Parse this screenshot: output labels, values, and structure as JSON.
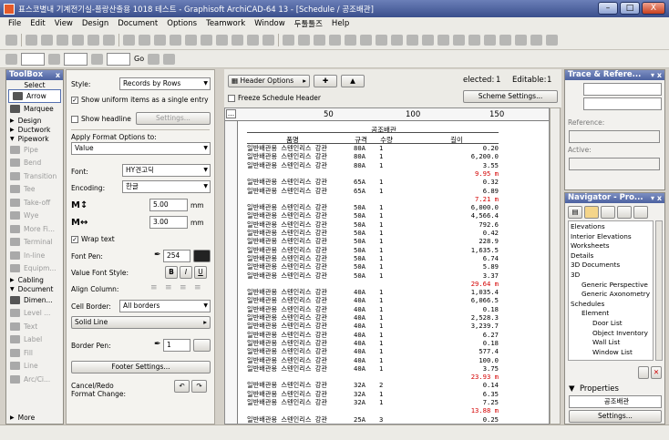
{
  "window": {
    "title": "표스코별내 기계전기실-플랑산출용 1018 테스트 - Graphisoft ArchiCAD-64 13 - [Schedule / 공조배관]",
    "min": "–",
    "max": "□",
    "close": "X"
  },
  "menu": [
    "File",
    "Edit",
    "View",
    "Design",
    "Document",
    "Options",
    "Teamwork",
    "Window",
    "두툴툴즈",
    "Help"
  ],
  "toolbar2": {
    "go_label": "Go"
  },
  "toolbox": {
    "title": "ToolBox",
    "close": "x",
    "select_label": "Select",
    "items_top": [
      {
        "label": "Arrow",
        "icon": "arrow-icon"
      },
      {
        "label": "Marquee",
        "icon": "marquee-icon"
      }
    ],
    "categories": [
      "Design",
      "Ductwork",
      "Pipework"
    ],
    "items_pipe": [
      "Pipe",
      "Bend",
      "Transition",
      "Tee",
      "Take-off",
      "Wye",
      "More Fi...",
      "Terminal",
      "In-line",
      "Equipm..."
    ],
    "cat_cabling": "Cabling",
    "cat_document": "Document",
    "items_doc": [
      "Dimen...",
      "Level ...",
      "Text",
      "Label",
      "Fill",
      "Line",
      "Arc/Ci..."
    ],
    "more": "More"
  },
  "infobox": {
    "style_label": "Style:",
    "style_value": "Records by Rows",
    "uniform_label": "Show uniform items as a single entry",
    "uniform_checked": true,
    "headline_label": "Show headline",
    "headline_checked": false,
    "settings_label": "Settings...",
    "apply_label": "Apply Format Options to:",
    "apply_value": "Value",
    "font_label": "Font:",
    "font_value": "HY견고딕",
    "encoding_label": "Encoding:",
    "encoding_value": "한글",
    "size1_value": "5.00",
    "size1_unit": "mm",
    "size2_value": "3.00",
    "size2_unit": "mm",
    "wrap_label": "Wrap text",
    "wrap_checked": true,
    "fontpen_label": "Font Pen:",
    "fontpen_value": "254",
    "valuefont_label": "Value Font Style:",
    "bold": "B",
    "italic": "I",
    "underline": "U",
    "align_label": "Align Column:",
    "cellborder_label": "Cell Border:",
    "cellborder_value": "All borders",
    "line_value": "Solid Line",
    "borderpen_label": "Border Pen:",
    "borderpen_value": "1",
    "footer_btn": "Footer Settings...",
    "cancel_label": "Cancel/Redo",
    "format_label": "Format Change:"
  },
  "schedule_toolbar": {
    "header_options": "Header Options",
    "elected_label": "elected:",
    "elected_value": "1",
    "editable_label": "Editable:",
    "editable_value": "1",
    "freeze_label": "Freeze Schedule Header",
    "scheme_btn": "Scheme Settings...",
    "ellipsis": "..."
  },
  "ruler": {
    "ticks": [
      "50",
      "100",
      "150"
    ]
  },
  "schedule": {
    "title": "공조배관",
    "headers": [
      "품명",
      "규격",
      "수량",
      "길이"
    ],
    "rows": [
      [
        "일반배관용 스텐인리스 강관",
        "80A",
        "1",
        "0.20",
        false
      ],
      [
        "일반배관용 스텐인리스 강관",
        "80A",
        "1",
        "6,200.0",
        false
      ],
      [
        "일반배관용 스텐인리스 강관",
        "80A",
        "1",
        "3.55",
        false
      ],
      [
        "",
        "",
        "",
        "9.95 m",
        true
      ],
      [
        "일반배관용 스텐인리스 강관",
        "65A",
        "1",
        "0.32",
        false
      ],
      [
        "일반배관용 스텐인리스 강관",
        "65A",
        "1",
        "6.89",
        false
      ],
      [
        "",
        "",
        "",
        "7.21 m",
        true
      ],
      [
        "일반배관용 스텐인리스 강관",
        "50A",
        "1",
        "6,000.0",
        false
      ],
      [
        "일반배관용 스텐인리스 강관",
        "50A",
        "1",
        "4,566.4",
        false
      ],
      [
        "일반배관용 스텐인리스 강관",
        "50A",
        "1",
        "792.6",
        false
      ],
      [
        "일반배관용 스텐인리스 강관",
        "50A",
        "1",
        "0.42",
        false
      ],
      [
        "일반배관용 스텐인리스 강관",
        "50A",
        "1",
        "228.9",
        false
      ],
      [
        "일반배관용 스텐인리스 강관",
        "50A",
        "1",
        "1,635.5",
        false
      ],
      [
        "일반배관용 스텐인리스 강관",
        "50A",
        "1",
        "6.74",
        false
      ],
      [
        "일반배관용 스텐인리스 강관",
        "50A",
        "1",
        "5.89",
        false
      ],
      [
        "일반배관용 스텐인리스 강관",
        "50A",
        "1",
        "3.37",
        false
      ],
      [
        "",
        "",
        "",
        "29.64 m",
        true
      ],
      [
        "일반배관용 스텐인리스 강관",
        "40A",
        "1",
        "1,035.4",
        false
      ],
      [
        "일반배관용 스텐인리스 강관",
        "40A",
        "1",
        "6,066.5",
        false
      ],
      [
        "일반배관용 스텐인리스 강관",
        "40A",
        "1",
        "0.18",
        false
      ],
      [
        "일반배관용 스텐인리스 강관",
        "40A",
        "1",
        "2,528.3",
        false
      ],
      [
        "일반배관용 스텐인리스 강관",
        "40A",
        "1",
        "3,239.7",
        false
      ],
      [
        "일반배관용 스텐인리스 강관",
        "40A",
        "1",
        "6.27",
        false
      ],
      [
        "일반배관용 스텐인리스 강관",
        "40A",
        "1",
        "0.18",
        false
      ],
      [
        "일반배관용 스텐인리스 강관",
        "40A",
        "1",
        "577.4",
        false
      ],
      [
        "일반배관용 스텐인리스 강관",
        "40A",
        "1",
        "100.0",
        false
      ],
      [
        "일반배관용 스텐인리스 강관",
        "40A",
        "1",
        "3.75",
        false
      ],
      [
        "",
        "",
        "",
        "23.93 m",
        true
      ],
      [
        "일반배관용 스텐인리스 강관",
        "32A",
        "2",
        "0.14",
        false
      ],
      [
        "일반배관용 스텐인리스 강관",
        "32A",
        "1",
        "6.35",
        false
      ],
      [
        "일반배관용 스텐인리스 강관",
        "32A",
        "1",
        "7.25",
        false
      ],
      [
        "",
        "",
        "",
        "13.88 m",
        true
      ],
      [
        "일반배관용 스텐인리스 강관",
        "25A",
        "3",
        "0.25",
        false
      ]
    ]
  },
  "trace": {
    "title": "Trace & Refere...",
    "reference_label": "Reference:",
    "active_label": "Active:"
  },
  "navigator": {
    "title": "Navigator - Pro...",
    "items": [
      {
        "label": "Elevations",
        "indent": 0
      },
      {
        "label": "Interior Elevations",
        "indent": 0
      },
      {
        "label": "Worksheets",
        "indent": 0
      },
      {
        "label": "Details",
        "indent": 0
      },
      {
        "label": "3D Documents",
        "indent": 0
      },
      {
        "label": "3D",
        "indent": 0
      },
      {
        "label": "Generic Perspective",
        "indent": 1
      },
      {
        "label": "Generic Axonometry",
        "indent": 1
      },
      {
        "label": "Schedules",
        "indent": 0
      },
      {
        "label": "Element",
        "indent": 1
      },
      {
        "label": "Door List",
        "indent": 2
      },
      {
        "label": "Object Inventory",
        "indent": 2
      },
      {
        "label": "Wall List",
        "indent": 2
      },
      {
        "label": "Window List",
        "indent": 2
      }
    ],
    "properties_label": "Properties",
    "current_name": "공조배관",
    "settings_btn": "Settings..."
  },
  "colors": {
    "titlebar": "#3a4f8c",
    "subtotal": "#d40000",
    "panel_bg": "#f2f1ee"
  }
}
